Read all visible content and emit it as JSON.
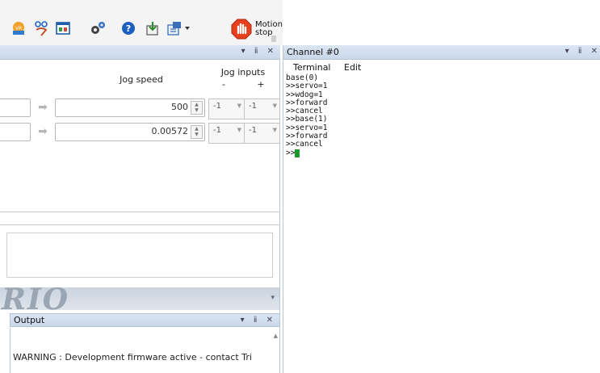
{
  "toolbar": {
    "icons": [
      "vr-icon",
      "tuning-icon",
      "screen-icon",
      "settings-gears-icon",
      "help-icon",
      "download-icon",
      "program-icon"
    ],
    "motion_stop_label_1": "Motion",
    "motion_stop_label_2": "stop",
    "motion_stop_color": "#e8401c"
  },
  "jog_pane": {
    "controls": "▾ ⅱ ✕",
    "jog_speed_header": "Jog speed",
    "jog_inputs_header": "Jog inputs",
    "jog_inputs_minus": "-",
    "jog_inputs_plus": "+",
    "rows": [
      {
        "speed": "500",
        "minus": "-1",
        "plus": "-1"
      },
      {
        "speed": "0.00572",
        "minus": "-1",
        "plus": "-1"
      }
    ]
  },
  "logo": {
    "text": "RIO"
  },
  "output": {
    "title": "Output",
    "controls": "▾ ⅱ ✕",
    "message": "WARNING : Development firmware active - contact Tri"
  },
  "channel": {
    "title": "Channel #0",
    "controls": "▾ ⅱ ✕",
    "menu": {
      "terminal": "Terminal",
      "edit": "Edit"
    },
    "lines": [
      "base(0)",
      ">>servo=1",
      ">>wdog=1",
      ">>forward",
      ">>cancel",
      ">>base(1)",
      ">>servo=1",
      ">>forward",
      ">>cancel"
    ],
    "prompt": ">>",
    "cursor_color": "#1a9a2a"
  }
}
